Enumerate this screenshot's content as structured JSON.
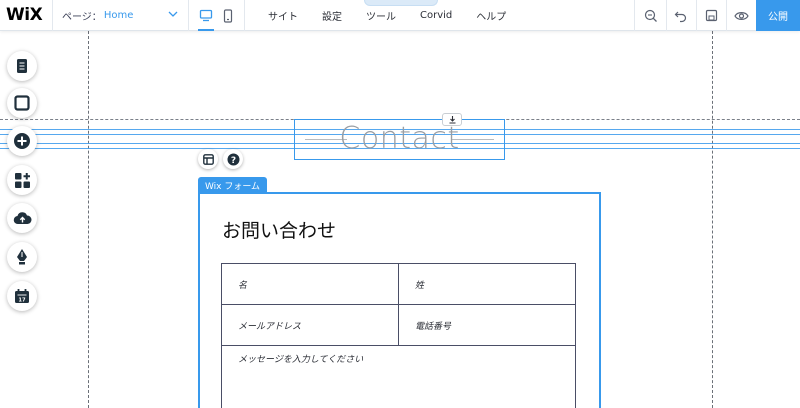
{
  "topbar": {
    "logo": "WiX",
    "page_label": "ページ：",
    "page_value": "Home",
    "menu": [
      "サイト",
      "設定",
      "ツール",
      "Corvid",
      "ヘルプ"
    ],
    "publish_label": "公開"
  },
  "canvas": {
    "title": "Contact"
  },
  "form": {
    "tag": "Wix フォーム",
    "title": "お問い合わせ",
    "fields": {
      "first_name": "名",
      "last_name": "姓",
      "email": "メールアドレス",
      "phone": "電話番号",
      "message": "メッセージを入力してください"
    }
  },
  "colors": {
    "accent": "#3899ec",
    "guide": "#6b7078",
    "field_border": "#4a4e66"
  }
}
